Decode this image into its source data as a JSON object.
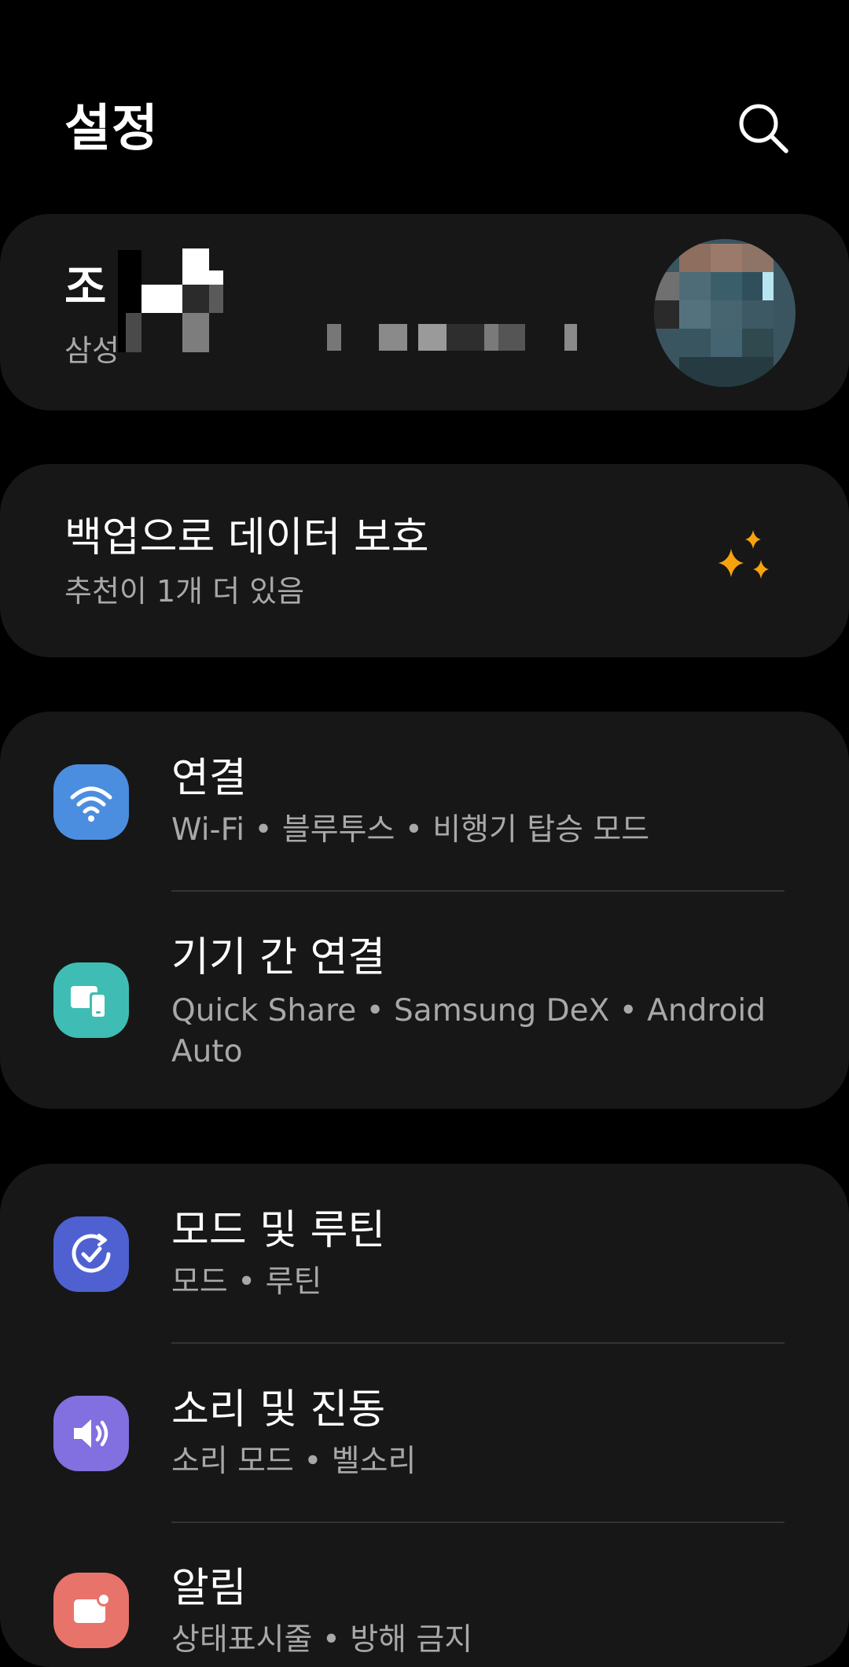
{
  "header": {
    "title": "설정",
    "search_icon": "search-icon"
  },
  "profile": {
    "name_visible": "조",
    "sub_visible": "삼성"
  },
  "backup": {
    "title": "백업으로 데이터 보호",
    "subtitle": "추천이 1개 더 있음",
    "icon": "sparkle-icon",
    "icon_color": "#f7a30e"
  },
  "groups": {
    "connections": {
      "title": "연결",
      "sub_parts": [
        "Wi-Fi",
        "블루투스",
        "비행기 탑승 모드"
      ],
      "icon": "wifi-icon",
      "icon_color": "#4b8ee0"
    },
    "connected_devices": {
      "title": "기기 간 연결",
      "sub_parts": [
        "Quick Share",
        "Samsung DeX",
        "Android Auto"
      ],
      "icon": "devices-icon",
      "icon_color": "#3fbdb4"
    },
    "modes_routines": {
      "title": "모드 및 루틴",
      "sub_parts": [
        "모드",
        "루틴"
      ],
      "icon": "modes-routines-icon",
      "icon_color": "#4f61d1"
    },
    "sounds": {
      "title": "소리 및 진동",
      "sub_parts": [
        "소리 모드",
        "벨소리"
      ],
      "icon": "speaker-icon",
      "icon_color": "#8270e0"
    },
    "notifications": {
      "title": "알림",
      "sub_parts": [
        "상태표시줄",
        "방해 금지"
      ],
      "icon": "notification-icon",
      "icon_color": "#e8736a"
    }
  }
}
